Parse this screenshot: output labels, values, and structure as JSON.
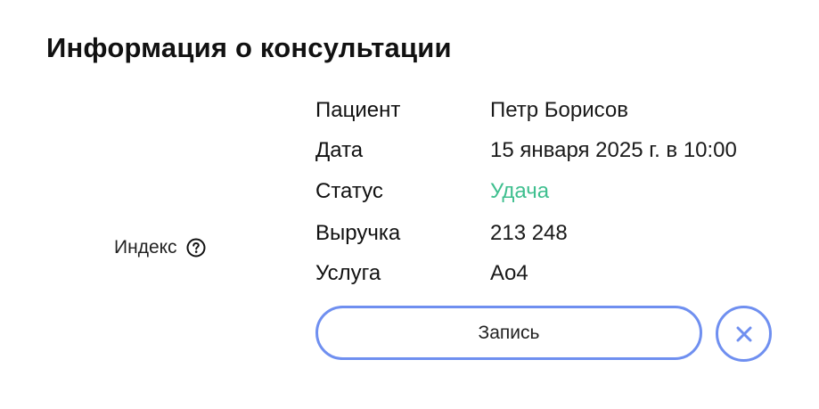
{
  "header": {
    "title": "Информация о консультации"
  },
  "index": {
    "label": "Индекс",
    "icon": "question-circle-icon"
  },
  "details": [
    {
      "key": "Пациент",
      "value": "Петр Борисов"
    },
    {
      "key": "Дата",
      "value": "15 января 2025 г. в 10:00"
    },
    {
      "key": "Статус",
      "value": "Удача"
    },
    {
      "key": "Выручка",
      "value": "213 248"
    },
    {
      "key": "Услуга",
      "value": "Ао4"
    }
  ],
  "actions": {
    "record_label": "Запись",
    "close_icon": "close-icon"
  },
  "colors": {
    "accent": "#6f8ff0",
    "status_success": "#3fbf8f",
    "text": "#111111"
  }
}
